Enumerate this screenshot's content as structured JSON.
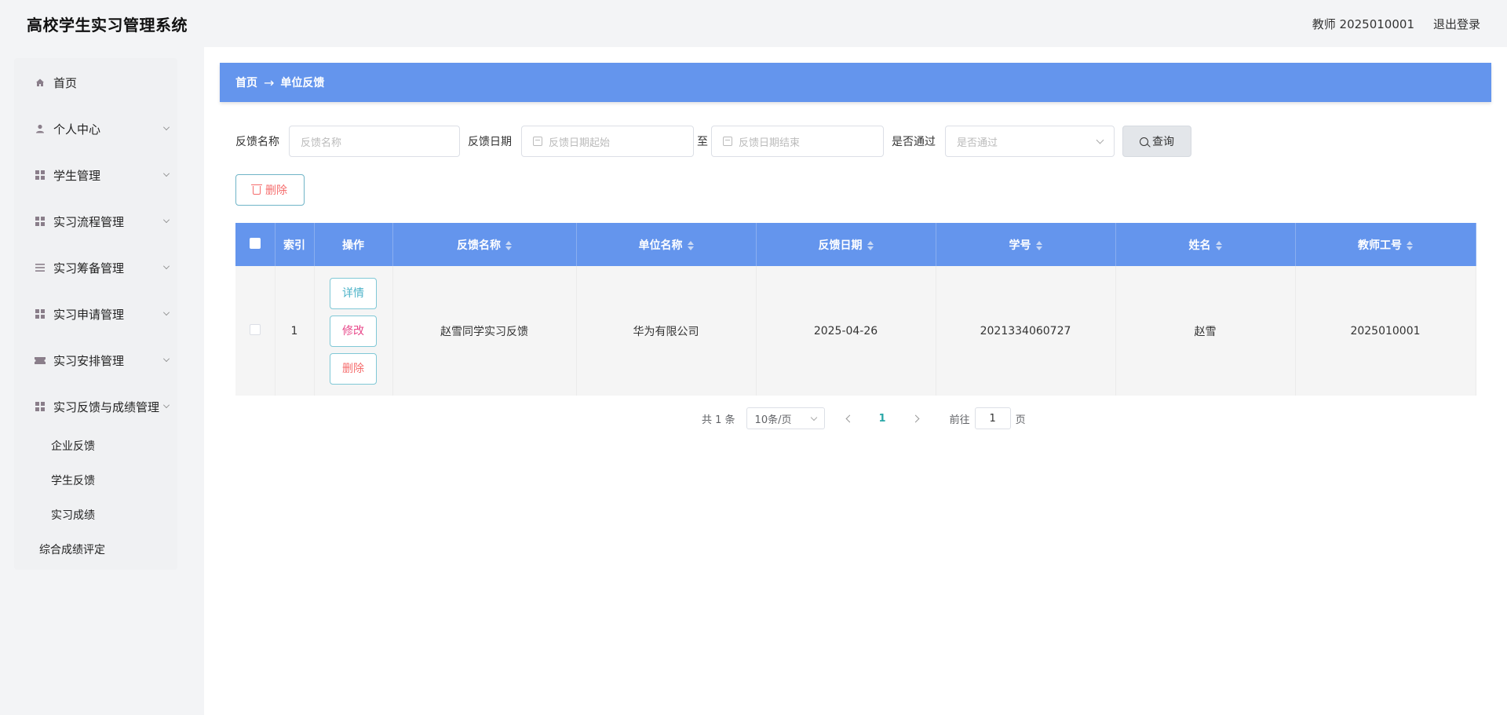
{
  "header": {
    "app_title": "高校学生实习管理系统",
    "user_label": "教师 2025010001",
    "logout": "退出登录"
  },
  "sidebar": {
    "items": [
      {
        "label": "首页",
        "icon": "home-icon"
      },
      {
        "label": "个人中心",
        "icon": "user-icon"
      },
      {
        "label": "学生管理",
        "icon": "grid-icon"
      },
      {
        "label": "实习流程管理",
        "icon": "grid-icon"
      },
      {
        "label": "实习筹备管理",
        "icon": "list-icon"
      },
      {
        "label": "实习申请管理",
        "icon": "grid-icon"
      },
      {
        "label": "实习安排管理",
        "icon": "ticket-icon"
      },
      {
        "label": "实习反馈与成绩管理",
        "icon": "grid-icon"
      }
    ],
    "sub_items": [
      "企业反馈",
      "学生反馈",
      "实习成绩"
    ],
    "extra_item": "综合成绩评定"
  },
  "breadcrumb": {
    "home": "首页",
    "arrow": "→",
    "current": "单位反馈"
  },
  "filters": {
    "name_label": "反馈名称",
    "name_placeholder": "反馈名称",
    "date_label": "反馈日期",
    "date_start_placeholder": "反馈日期起始",
    "date_to": "至",
    "date_end_placeholder": "反馈日期结束",
    "pass_label": "是否通过",
    "pass_placeholder": "是否通过",
    "query_button": "查询"
  },
  "actions": {
    "delete_button": "删除"
  },
  "table": {
    "columns": [
      "索引",
      "操作",
      "反馈名称",
      "单位名称",
      "反馈日期",
      "学号",
      "姓名",
      "教师工号"
    ],
    "row_actions": {
      "detail": "详情",
      "edit": "修改",
      "delete": "删除"
    },
    "rows": [
      {
        "index": "1",
        "feedback_name": "赵雪同学实习反馈",
        "company": "华为有限公司",
        "date": "2025-04-26",
        "student_id": "2021334060727",
        "name": "赵雪",
        "teacher_id": "2025010001"
      }
    ]
  },
  "pagination": {
    "total": "共 1 条",
    "page_size": "10条/页",
    "current_page": "1",
    "goto_label": "前往",
    "goto_value": "1",
    "page_unit": "页"
  },
  "colors": {
    "primary_blue": "#6495ed",
    "danger_red": "#f56c6c",
    "edit_pink": "#e8488a",
    "detail_teal": "#4db3c8"
  }
}
